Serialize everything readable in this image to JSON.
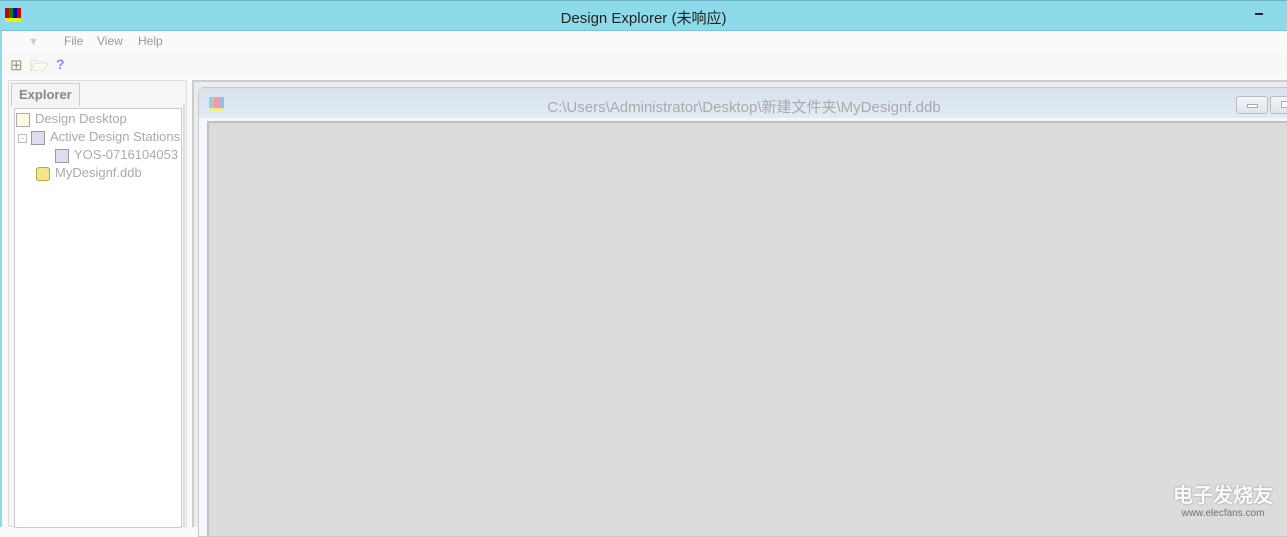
{
  "window": {
    "title": "Design Explorer (未响应)"
  },
  "menu": [
    "File",
    "View",
    "Help"
  ],
  "toolbar": {
    "tree_icon": "tree-icon",
    "open_icon": "folder-open-icon",
    "help_icon": "?"
  },
  "explorer": {
    "tab": "Explorer",
    "tree": [
      {
        "label": "Design Desktop"
      },
      {
        "label": "Active Design Stations"
      },
      {
        "label": "YOS-0716104053"
      },
      {
        "label": "MyDesignf.ddb"
      }
    ]
  },
  "document": {
    "title": "C:\\Users\\Administrator\\Desktop\\新建文件夹\\MyDesignf.ddb"
  },
  "watermark": {
    "brand": "电子发烧友",
    "url": "www.elecfans.com"
  }
}
